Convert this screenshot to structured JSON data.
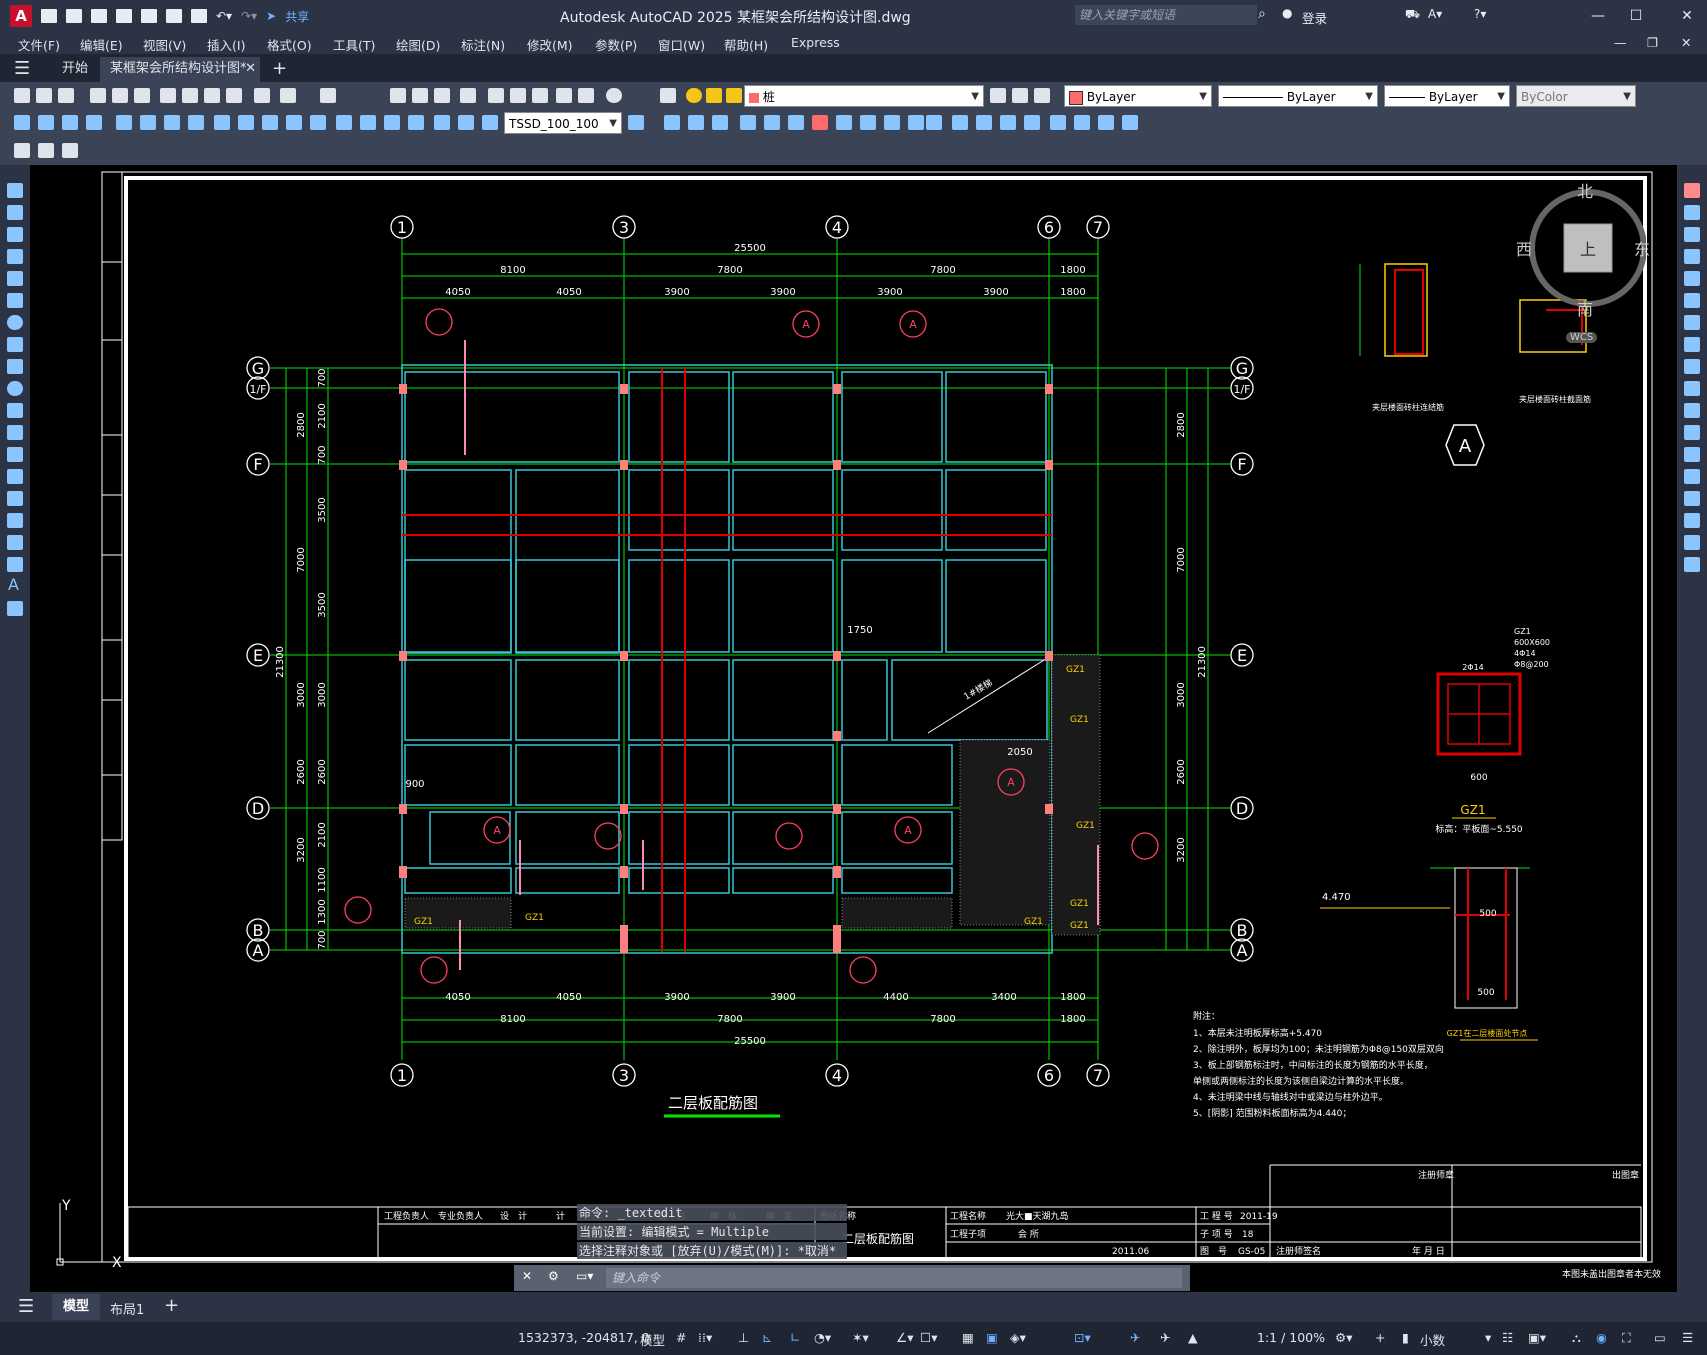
{
  "app": {
    "title": "Autodesk AutoCAD 2025    某框架会所结构设计图.dwg",
    "share_label": "共享",
    "search_placeholder": "键入关键字或短语",
    "login_label": "登录",
    "logo_letter": "A"
  },
  "menu": [
    "文件(F)",
    "编辑(E)",
    "视图(V)",
    "插入(I)",
    "格式(O)",
    "工具(T)",
    "绘图(D)",
    "标注(N)",
    "修改(M)",
    "参数(P)",
    "窗口(W)",
    "帮助(H)",
    "Express"
  ],
  "tabs": {
    "start": "开始",
    "active": "某框架会所结构设计图*",
    "add": "+"
  },
  "properties": {
    "layer": "桩",
    "color": "ByLayer",
    "linetype": "ByLayer",
    "lineweight": "ByLayer",
    "plotstyle": "ByColor",
    "dimstyle": "TSSD_100_100"
  },
  "viewcube": {
    "north": "北",
    "south": "南",
    "east": "东",
    "west": "西",
    "face": "上",
    "wcs": "WCS"
  },
  "drawing": {
    "plan_title": "二层板配筋图",
    "grid_top": [
      "1",
      "3",
      "4",
      "6",
      "7"
    ],
    "grid_side": [
      "G",
      "1/F",
      "F",
      "E",
      "D",
      "B",
      "A"
    ],
    "dims_total": "25500",
    "dims_row1": [
      "8100",
      "7800",
      "7800",
      "1800"
    ],
    "dims_row2": [
      "4050",
      "4050",
      "3900",
      "3900",
      "3900",
      "3900",
      "1800"
    ],
    "dims_bottom2": [
      "4050",
      "4050",
      "3900",
      "3900",
      "4400",
      "3400",
      "1800"
    ],
    "dims_left_total": "21300",
    "dims_left_a": [
      "2800",
      "7000",
      "3000",
      "2600",
      "3200"
    ],
    "dims_left_b": [
      "700",
      "2100",
      "700",
      "3500",
      "3500",
      "3000",
      "2600",
      "2100",
      "1100",
      "1300",
      "700"
    ],
    "section_a": "A",
    "detail1_title": "夹层楼面砖柱连结筋",
    "detail2_title": "夹层楼面砖柱截面筋",
    "gz1_label": "GZ1",
    "gz1_spec": [
      "GZ1",
      "600X600",
      "4Φ14",
      "Φ8@200"
    ],
    "gz1_dim": "600",
    "gz1_dim2": "2Φ14",
    "gz1_note": "标高：平板面~5.550",
    "gz1_detail_title": "GZ1在二层楼面处节点",
    "elev_label": "4.470",
    "dim_500": "500",
    "notes_title": "附注：",
    "notes": [
      "1、本层未注明板厚标高+5.470",
      "2、除注明外，板厚均为100；未注明钢筋为Φ8@150双层双向",
      "3、板上部钢筋标注时，中间标注的长度为钢筋的水平长度，",
      "   单侧或两侧标注的长度为该侧自梁边计算的水平长度。",
      "4、未注明梁中线与轴线对中或梁边与柱外边平。",
      "5、[阴影] 范围粉料板面标高为4.440；"
    ],
    "annotations": {
      "stair": "1#楼梯",
      "dim1750": "1750",
      "dim2050": "2050",
      "dim900": "900"
    },
    "titleblock": {
      "roles": [
        "工程负责人",
        "专业负责人",
        "设　计",
        "计",
        "校　对",
        "审　核",
        "审　定"
      ],
      "drawing_name_label": "图纸名称",
      "drawing_name": "二层板配筋图",
      "project_label": "工程名称",
      "project": "光大■天湖九岛",
      "sub_label": "工程子项",
      "sub": "会 所",
      "proj_no_label": "工 程 号",
      "proj_no": "2011-19",
      "sub_no_label": "子 项 号",
      "sub_no": "18",
      "fig_label": "图　号",
      "fig_no": "GS-05",
      "date": "2011.06",
      "reg_label": "注册师签名",
      "stamp_label": "出图章",
      "reg_seal_label": "注册师章",
      "date_label": "年 月 日",
      "footer": "本图未盖出图章者本无效"
    }
  },
  "commandline": {
    "history": [
      "命令: _textedit",
      "当前设置: 编辑模式 = Multiple",
      "选择注释对象或 [放弃(U)/模式(M)]: *取消*"
    ],
    "placeholder": "键入命令"
  },
  "layout_tabs": [
    "模型",
    "布局1",
    "+"
  ],
  "status": {
    "coords": "1532373, -204817, 0",
    "mode": "模型",
    "scale": "1:1 / 100%",
    "units": "小数"
  }
}
